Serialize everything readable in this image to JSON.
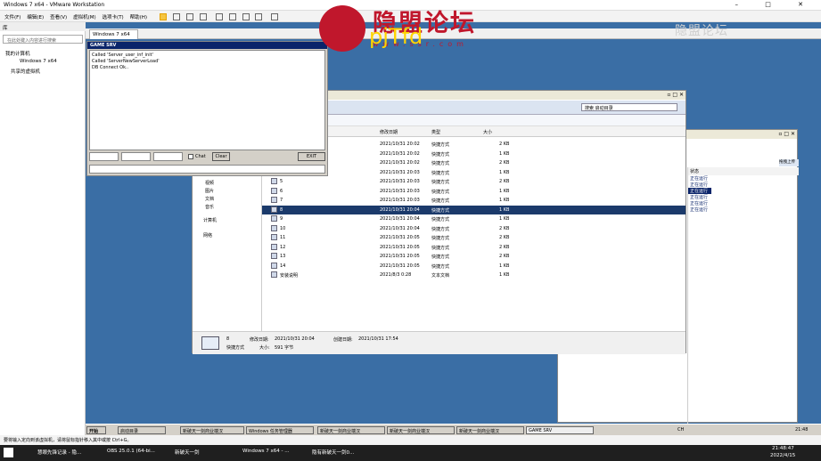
{
  "vm": {
    "title": "Windows 7 x64 - VMware Workstation",
    "window_buttons": [
      "–",
      "□",
      "✕"
    ],
    "menu": [
      "文件(F)",
      "编辑(E)",
      "查看(V)",
      "虚拟机(M)",
      "选项卡(T)",
      "帮助(H)"
    ],
    "library_title": "库",
    "library_search": "在此处键入内容进行搜索",
    "tree": [
      "我的计算机",
      "Windows 7 x64",
      "共享的虚拟机"
    ],
    "tab": "Windows 7 x64"
  },
  "server": {
    "title": "GAME SRV",
    "log": [
      "Called 'Server_user_inf_init'",
      "Called 'ServerNewServerLoad'",
      "DB Connect Ok.."
    ],
    "chat": "Chat",
    "clear": "Clear",
    "exit": "EXIT"
  },
  "explorer": {
    "search_placeholder": "搜索 启动目录",
    "columns": [
      "修改日期",
      "类型",
      "大小"
    ],
    "left_items": [
      "视频",
      "图片",
      "文档",
      "音乐",
      "计算机",
      "网络"
    ],
    "rows": [
      {
        "name": "",
        "date": "2021/10/31 20:02",
        "type": "快捷方式",
        "size": "2 KB"
      },
      {
        "name": "",
        "date": "2021/10/31 20:02",
        "type": "快捷方式",
        "size": "1 KB"
      },
      {
        "name": "",
        "date": "2021/10/31 20:02",
        "type": "快捷方式",
        "size": "2 KB"
      },
      {
        "name": "",
        "date": "2021/10/31 20:03",
        "type": "快捷方式",
        "size": "1 KB"
      },
      {
        "name": "5",
        "date": "2021/10/31 20:03",
        "type": "快捷方式",
        "size": "2 KB"
      },
      {
        "name": "6",
        "date": "2021/10/31 20:03",
        "type": "快捷方式",
        "size": "1 KB"
      },
      {
        "name": "7",
        "date": "2021/10/31 20:03",
        "type": "快捷方式",
        "size": "1 KB"
      },
      {
        "name": "8",
        "date": "2021/10/31 20:04",
        "type": "快捷方式",
        "size": "1 KB"
      },
      {
        "name": "9",
        "date": "2021/10/31 20:04",
        "type": "快捷方式",
        "size": "1 KB"
      },
      {
        "name": "10",
        "date": "2021/10/31 20:04",
        "type": "快捷方式",
        "size": "2 KB"
      },
      {
        "name": "11",
        "date": "2021/10/31 20:05",
        "type": "快捷方式",
        "size": "2 KB"
      },
      {
        "name": "12",
        "date": "2021/10/31 20:05",
        "type": "快捷方式",
        "size": "2 KB"
      },
      {
        "name": "13",
        "date": "2021/10/31 20:05",
        "type": "快捷方式",
        "size": "2 KB"
      },
      {
        "name": "14",
        "date": "2021/10/31 20:05",
        "type": "快捷方式",
        "size": "1 KB"
      },
      {
        "name": "安装说明",
        "date": "2021/8/3 0:28",
        "type": "文本文档",
        "size": "1 KB"
      }
    ],
    "selected_index": 7,
    "details": {
      "name": "8",
      "type": "快捷方式",
      "modified_label": "修改日期:",
      "modified": "2021/10/31 20:04",
      "created_label": "创建日期:",
      "created": "2021/10/31 17:54",
      "size_label": "大小:",
      "size": "591 字节"
    }
  },
  "right_window": {
    "header": "状态",
    "upload": "拖拽上传",
    "statuses": [
      "正在运行",
      "正在运行",
      "正在运行",
      "正在运行",
      "正在运行",
      "正在运行"
    ]
  },
  "guest_taskbar": {
    "start": "开始",
    "items": [
      "启动目录",
      "新破天一剑商业端汉",
      "Windows 任务管理器",
      "新破天一剑商业端汉",
      "新破天一剑商业端汉",
      "新破天一剑商业端汉",
      "GAME SRV"
    ],
    "tray_lang": "CH",
    "time": "21:48"
  },
  "status_bar": "要将输入定向到该虚拟机，请将鼠标指针移入其中或按 Ctrl+G。",
  "host_taskbar": {
    "items": [
      "慧眼先锋记录 - 隐...",
      "OBS 25.0.1 (64-bi...",
      "新破天一剑",
      "Windows 7 x64 - ...",
      "隐有新破天一剑0..."
    ],
    "time": "21:48:47",
    "date": "2022/4/15"
  },
  "watermark": {
    "brand": "隐盟论坛",
    "sub": "www.ssr.com",
    "handle": "pjTfd",
    "corner": "隐盟论坛"
  }
}
